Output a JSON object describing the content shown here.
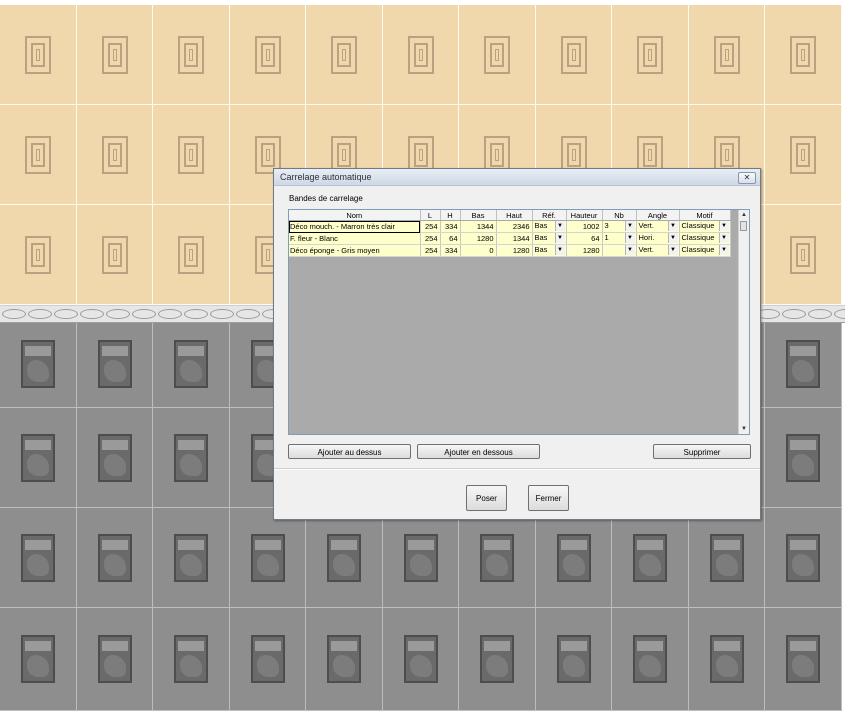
{
  "dialog": {
    "title": "Carrelage automatique",
    "close_label": "✕",
    "group_label": "Bandes de carrelage",
    "columns": [
      "Nom",
      "L",
      "H",
      "Bas",
      "Haut",
      "Réf.",
      "Hauteur",
      "Nb",
      "Angle",
      "Motif"
    ],
    "rows": [
      {
        "nom": "Déco mouch. - Marron très clair",
        "l": "254",
        "h": "334",
        "bas": "1344",
        "haut": "2346",
        "ref": "Bas",
        "hauteur": "1002",
        "nb": "3",
        "angle": "Vert.",
        "motif": "Classique"
      },
      {
        "nom": "F. fleur - Blanc",
        "l": "254",
        "h": "64",
        "bas": "1280",
        "haut": "1344",
        "ref": "Bas",
        "hauteur": "64",
        "nb": "1",
        "angle": "Hori.",
        "motif": "Classique"
      },
      {
        "nom": "Déco éponge - Gris moyen",
        "l": "254",
        "h": "334",
        "bas": "0",
        "haut": "1280",
        "ref": "Bas",
        "hauteur": "1280",
        "nb": "",
        "angle": "Vert.",
        "motif": "Classique"
      }
    ],
    "buttons": {
      "add_above": "Ajouter au dessus",
      "add_below": "Ajouter en dessous",
      "delete": "Supprimer",
      "poser": "Poser",
      "fermer": "Fermer"
    }
  },
  "colors": {
    "beige_tile": "#f1d7ac",
    "gray_tile": "#8e8e8e",
    "grid_row": "#ffffcc",
    "grid_empty": "#aaaaaa"
  }
}
